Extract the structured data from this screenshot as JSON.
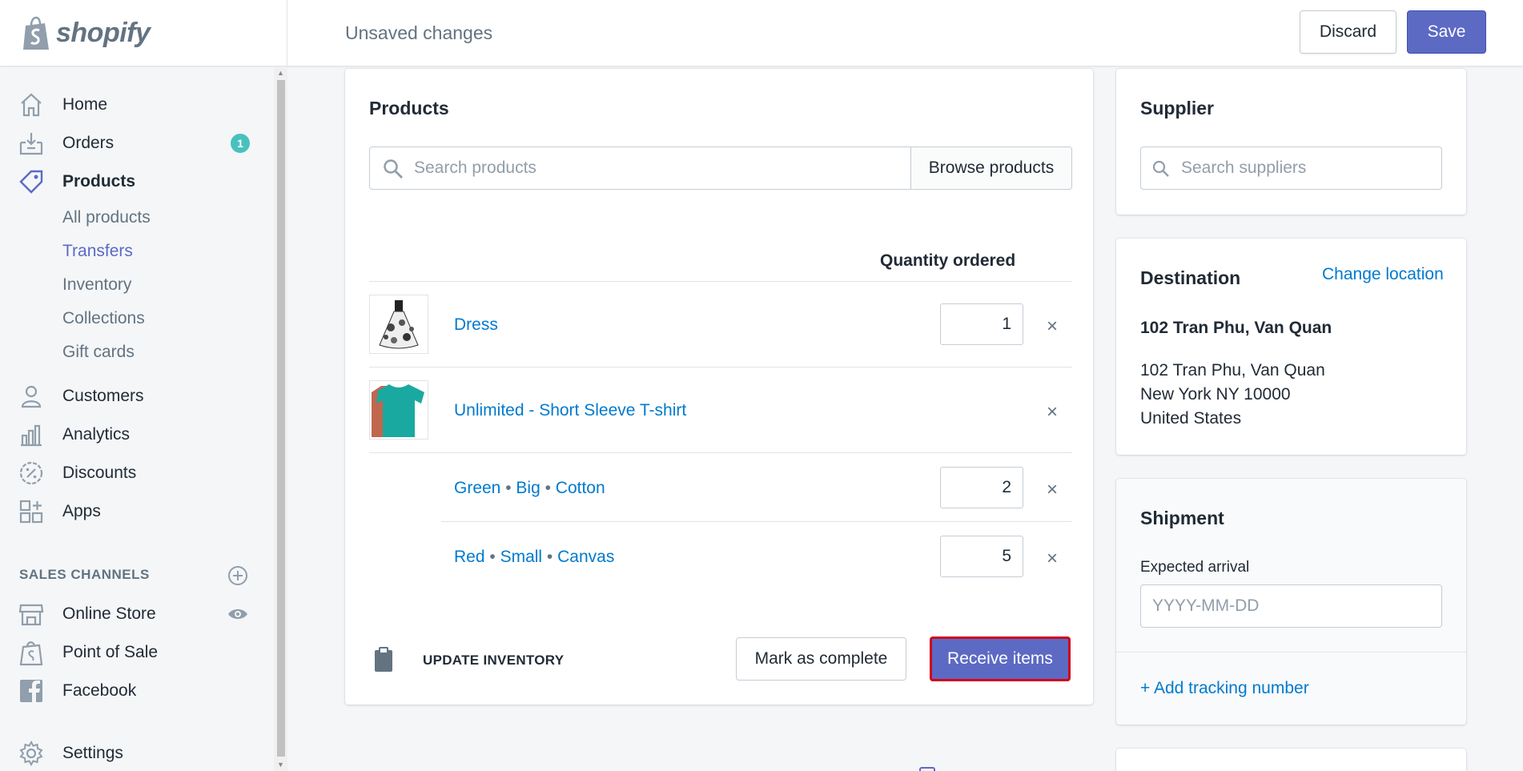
{
  "topbar": {
    "logo_text": "shopify",
    "status": "Unsaved changes",
    "discard_label": "Discard",
    "save_label": "Save"
  },
  "sidebar": {
    "home": "Home",
    "orders": "Orders",
    "orders_badge": "1",
    "products": "Products",
    "sub": [
      "All products",
      "Transfers",
      "Inventory",
      "Collections",
      "Gift cards"
    ],
    "customers": "Customers",
    "analytics": "Analytics",
    "discounts": "Discounts",
    "apps": "Apps",
    "sales_channels": "SALES CHANNELS",
    "online_store": "Online Store",
    "point_of_sale": "Point of Sale",
    "facebook": "Facebook",
    "settings": "Settings"
  },
  "products_card": {
    "title": "Products",
    "search_placeholder": "Search products",
    "browse_label": "Browse products",
    "qty_header": "Quantity ordered",
    "items": [
      {
        "name": "Dress",
        "qty": "1"
      },
      {
        "name": "Unlimited - Short Sleeve T-shirt"
      },
      {
        "variant": [
          "Green",
          "Big",
          "Cotton"
        ],
        "qty": "2"
      },
      {
        "variant": [
          "Red",
          "Small",
          "Canvas"
        ],
        "qty": "5"
      }
    ],
    "update_inventory": "UPDATE INVENTORY",
    "mark_complete": "Mark as complete",
    "receive_items": "Receive items"
  },
  "supplier": {
    "title": "Supplier",
    "search_placeholder": "Search suppliers"
  },
  "destination": {
    "title": "Destination",
    "change_location": "Change location",
    "name": "102 Tran Phu, Van Quan",
    "line1": "102 Tran Phu, Van Quan",
    "line2": "New York NY 10000",
    "line3": "United States"
  },
  "shipment": {
    "title": "Shipment",
    "expected_label": "Expected arrival",
    "date_placeholder": "YYYY-MM-DD",
    "add_tracking": "+ Add tracking number"
  },
  "colors": {
    "accent": "#5c6ac4",
    "link": "#007ace",
    "badge": "#47c1bf",
    "highlight_border": "#d0021b"
  }
}
